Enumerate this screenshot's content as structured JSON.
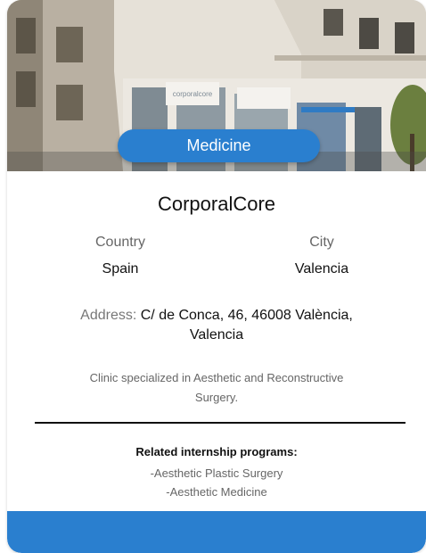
{
  "card": {
    "category": "Medicine",
    "name": "CorporalCore",
    "country_label": "Country",
    "country_value": "Spain",
    "city_label": "City",
    "city_value": "Valencia",
    "address_label": "Address:",
    "address_value": "C/ de Conca, 46, 46008 València, Valencia",
    "description": "Clinic specialized in Aesthetic and Reconstructive Surgery.",
    "programs_title": "Related internship programs:",
    "programs": [
      "-Aesthetic Plastic Surgery",
      "-Aesthetic Medicine"
    ],
    "photo_sign_text": "corporalcore",
    "colors": {
      "accent": "#2a7fcf",
      "title_text": "#111111",
      "muted_text": "#666666"
    }
  }
}
